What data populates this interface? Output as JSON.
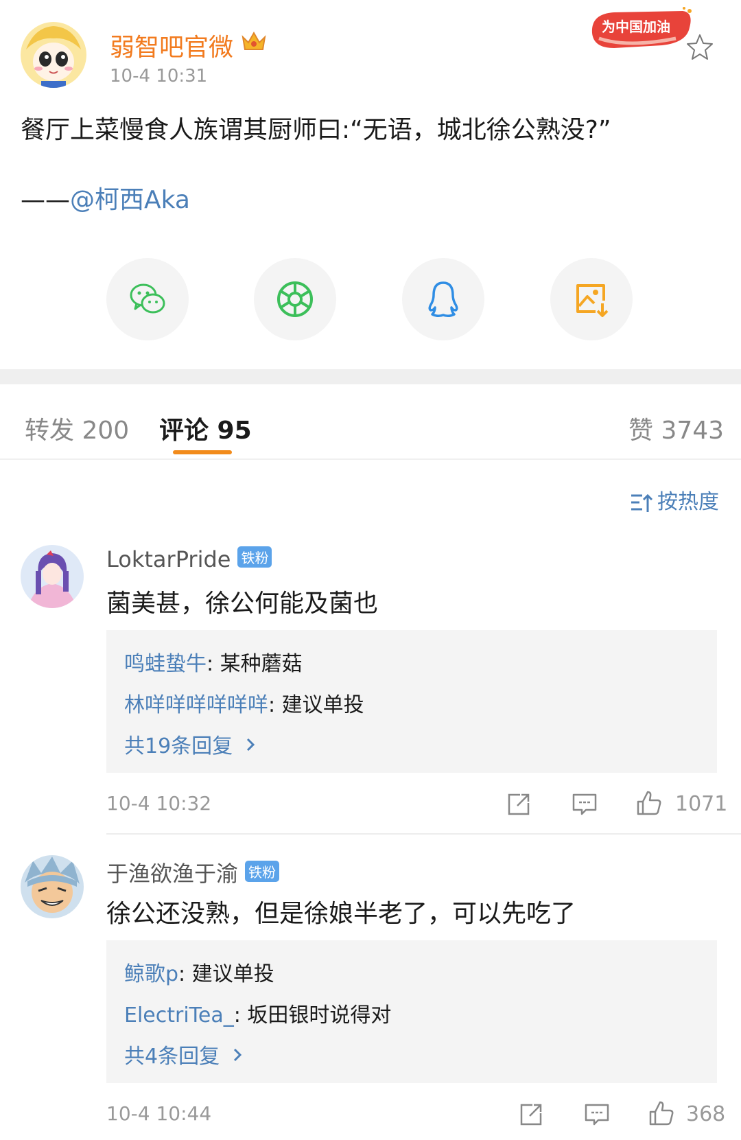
{
  "post": {
    "author": "弱智吧官微",
    "time": "10-4 10:31",
    "badge_text": "为中国加油",
    "body": "餐厅上菜慢食人族谓其厨师曰:“无语，城北徐公熟没?”",
    "credit_prefix": "——",
    "credit_mention": "@柯西Aka"
  },
  "share": [
    {
      "name": "wechat",
      "color": "#3cbf5a"
    },
    {
      "name": "moments",
      "color": "#3cbf5a"
    },
    {
      "name": "qq",
      "color": "#2f8de4"
    },
    {
      "name": "save-image",
      "color": "#f5a623"
    }
  ],
  "tabs": {
    "reposts": "转发 200",
    "comments": "评论 95",
    "likes": "赞 3743"
  },
  "sort_label": "按热度",
  "comments": [
    {
      "user": "LoktarPride",
      "badge": "铁粉",
      "text": "菌美甚，徐公何能及菌也",
      "replies": [
        {
          "name": "鸣蛙蛰牛",
          "text": ": 某种蘑菇"
        },
        {
          "name": "林咩咩咩咩咩咩",
          "text": ": 建议单投"
        }
      ],
      "more": "共19条回复",
      "time": "10-4 10:32",
      "likes": "1071"
    },
    {
      "user": "于渔欲渔于渝",
      "badge": "铁粉",
      "text": "徐公还没熟，但是徐娘半老了，可以先吃了",
      "replies": [
        {
          "name": "鲸歌p",
          "text": ": 建议单投"
        },
        {
          "name": "ElectriTea_",
          "text": ": 坂田银时说得对"
        }
      ],
      "more": "共4条回复",
      "time": "10-4 10:44",
      "likes": "368"
    }
  ],
  "colors": {
    "accent": "#f28b1b",
    "link": "#4b7fb8",
    "author": "#f27b1f"
  }
}
